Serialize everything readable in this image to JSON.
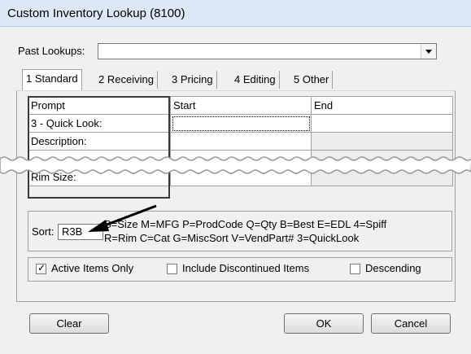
{
  "window": {
    "title": "Custom Inventory Lookup (8100)"
  },
  "past_lookups": {
    "label": "Past Lookups:",
    "value": ""
  },
  "tabs": [
    {
      "label": "1 Standard",
      "active": true
    },
    {
      "label": "2 Receiving",
      "active": false
    },
    {
      "label": "3 Pricing",
      "active": false
    },
    {
      "label": "4 Editing",
      "active": false
    },
    {
      "label": "5 Other",
      "active": false
    }
  ],
  "grid": {
    "headers": [
      "Prompt",
      "Start",
      "End"
    ],
    "rows": [
      {
        "prompt": "3 - Quick Look:",
        "start": "",
        "end": ""
      },
      {
        "prompt": "Description:",
        "start": "",
        "end": ""
      },
      {
        "prompt": "Rim Size:",
        "start": "",
        "end": ""
      }
    ]
  },
  "sort": {
    "label": "Sort:",
    "value": "R3B",
    "legend_line1": "S=Size  M=MFG  P=ProdCode  Q=Qty  B=Best   E=EDL  4=Spiff",
    "legend_line2": "R=Rim   C=Cat    G=MiscSort   V=VendPart#     3=QuickLook"
  },
  "options": {
    "active_items": {
      "label": "Active Items Only",
      "checked": true
    },
    "include_discontinued": {
      "label": "Include Discontinued Items",
      "checked": false
    },
    "descending": {
      "label": "Descending",
      "checked": false
    }
  },
  "buttons": {
    "clear": "Clear",
    "ok": "OK",
    "cancel": "Cancel"
  },
  "colors": {
    "titlebar": "#dce8f5",
    "face": "#f0f0f0",
    "arrow": "#000000"
  }
}
